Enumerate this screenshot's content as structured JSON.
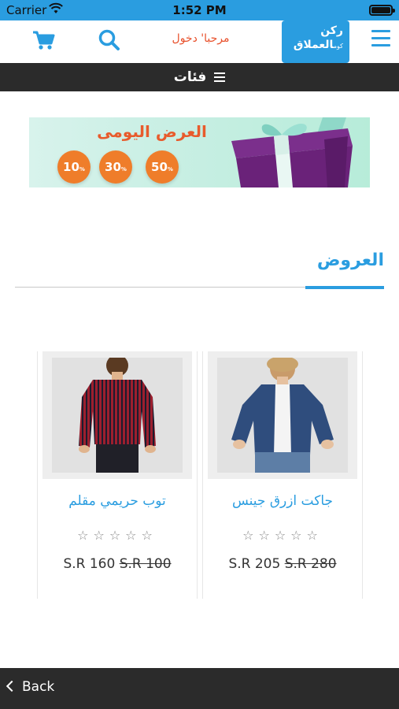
{
  "status_bar": {
    "carrier": "Carrier",
    "time": "1:52 PM"
  },
  "header": {
    "login_text": "مرحبا' دخول",
    "logo": {
      "line1": "ركن",
      "line2": "العملاق",
      "line3": "كوم"
    }
  },
  "category_bar": {
    "label": "فئات"
  },
  "banner": {
    "title": "العرض اليومى",
    "discounts": [
      {
        "value": "50",
        "unit": "%"
      },
      {
        "value": "30",
        "unit": "%"
      },
      {
        "value": "10",
        "unit": "%"
      }
    ]
  },
  "section": {
    "title": "العروض"
  },
  "products": [
    {
      "name": "جاكت ازرق جينس",
      "price": "S.R 205",
      "old_price": "S.R 280",
      "rating": 0,
      "stars": "☆☆☆☆☆"
    },
    {
      "name": "توب حريمي مقلم",
      "price": "S.R 160",
      "old_price": "S.R 100",
      "rating": 0,
      "stars": "☆☆☆☆☆"
    }
  ],
  "bottom_bar": {
    "back_label": "Back"
  },
  "colors": {
    "brand": "#2a9de0",
    "accent": "#e8502b",
    "dark_bar": "#2b2b2b",
    "discount": "#ef7d2a"
  }
}
